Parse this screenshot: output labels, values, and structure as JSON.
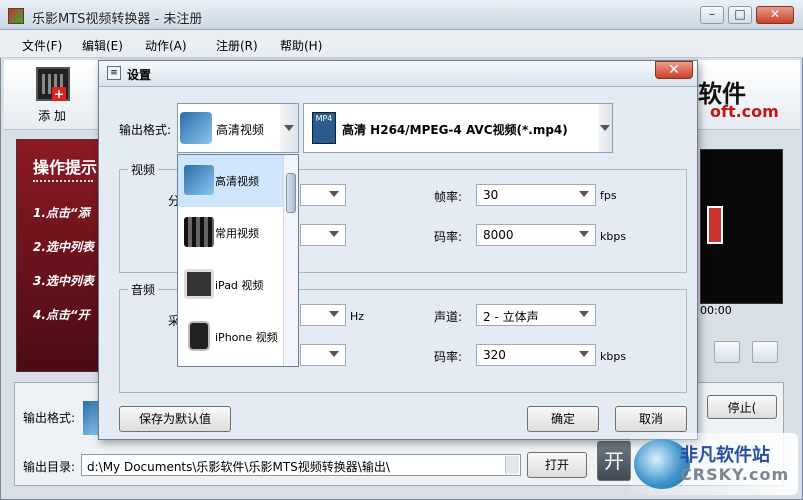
{
  "app": {
    "title": "乐影MTS视频转换器 - 未注册",
    "menu": [
      "文件(F)",
      "编辑(E)",
      "动作(A)",
      "注册(R)",
      "帮助(H)"
    ],
    "toolbar": {
      "add_label": "添 加"
    },
    "brand": {
      "line1": "软件",
      "line2": "oft.com"
    },
    "tips": {
      "title": "操作提示",
      "items": [
        "1.点击“添",
        "2.选中列表",
        "3.选中列表",
        "4.点击“开"
      ]
    },
    "preview": {
      "time": "00:00"
    },
    "bottom": {
      "output_format_label": "输出格式:",
      "output_dir_label": "输出目录:",
      "output_dir_value": "d:\\My Documents\\乐影软件\\乐影MTS视频转换器\\输出\\",
      "open_button": "打开",
      "stop_button": "停止(",
      "start_button": "开"
    }
  },
  "dialog": {
    "title": "设置",
    "close_glyph": "✕",
    "output_format_label": "输出格式:",
    "format_selected": "高清视频",
    "codec_selected": "高清 H264/MPEG-4 AVC视频(*.mp4)",
    "format_options": [
      "高清视频",
      "常用视频",
      "iPad 视频",
      "iPhone 视频"
    ],
    "video_group": {
      "title": "视频",
      "left_label_partial": "分",
      "framerate_label": "帧率:",
      "framerate_value": "30",
      "framerate_unit": "fps",
      "bitrate_label": "码率:",
      "bitrate_value": "8000",
      "bitrate_unit": "kbps"
    },
    "audio_group": {
      "title": "音频",
      "left_label_partial": "采",
      "samplerate_unit": "Hz",
      "channel_label": "声道:",
      "channel_value": "2 - 立体声",
      "bitrate_label": "码率:",
      "bitrate_value": "320",
      "bitrate_unit": "kbps"
    },
    "buttons": {
      "save_default": "保存为默认值",
      "ok": "确定",
      "cancel": "取消"
    }
  },
  "watermark": {
    "cn": "非凡软件站",
    "en": "CRSKY.com"
  },
  "colors": {
    "panel_red": "#8c1a24",
    "selection": "#cfe5fb",
    "brand_red": "#c01818"
  }
}
